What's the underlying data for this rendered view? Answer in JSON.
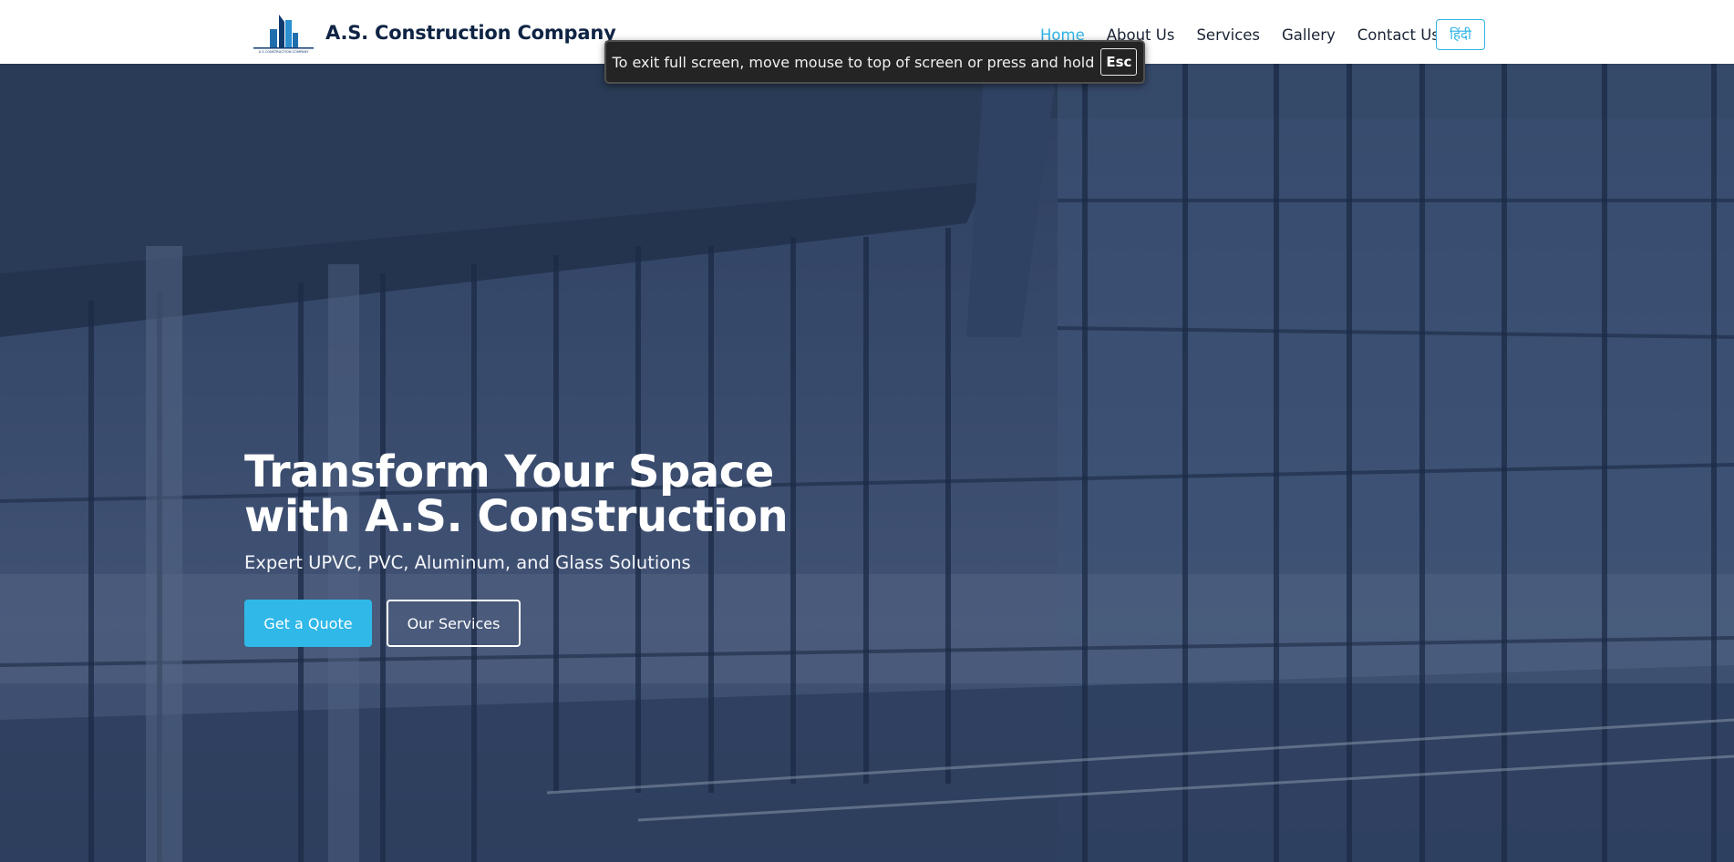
{
  "navbar": {
    "brand_name": "A.S. Construction Company",
    "logo_tagline": "A S CONSTRUCTION COMPANY",
    "links": [
      {
        "label": "Home",
        "active": true
      },
      {
        "label": "About Us",
        "active": false
      },
      {
        "label": "Services",
        "active": false
      },
      {
        "label": "Gallery",
        "active": false
      },
      {
        "label": "Contact Us",
        "active": false
      }
    ],
    "language_button": "हिंदी"
  },
  "hero": {
    "title_line1": "Transform Your Space",
    "title_line2": "with A.S. Construction",
    "subtitle": "Expert UPVC, PVC, Aluminum, and Glass Solutions",
    "primary_button": "Get a Quote",
    "secondary_button": "Our Services"
  },
  "fullscreen_notice": {
    "text": "To exit full screen, move mouse to top of screen or press and hold",
    "key": "Esc"
  },
  "colors": {
    "accent": "#2fb3e6",
    "brand_text": "#0f2444",
    "nav_text": "#1b2434",
    "hero_overlay": "#1e3258"
  }
}
